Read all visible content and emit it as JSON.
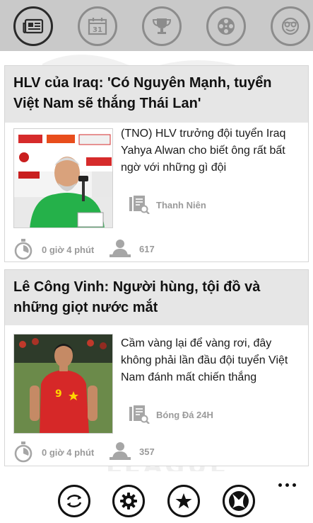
{
  "tabs": [
    {
      "icon": "news-icon",
      "active": true
    },
    {
      "icon": "calendar-icon",
      "day": "31",
      "active": false
    },
    {
      "icon": "trophy-icon",
      "active": false
    },
    {
      "icon": "film-reel-icon",
      "active": false
    },
    {
      "icon": "mask-icon",
      "active": false
    }
  ],
  "articles": [
    {
      "title": "HLV của Iraq: 'Có Nguyên Mạnh, tuyển Việt Nam sẽ thắng Thái Lan'",
      "summary": "(TNO) HLV trưởng đội tuyển Iraq Yahya Alwan cho biết ông rất bất ngờ với những gì đội",
      "source": "Thanh Niên",
      "time": "0 giờ 4 phút",
      "views": "617"
    },
    {
      "title": "Lê Công Vinh: Người hùng, tội đồ và những giọt nước mắt",
      "summary": "Cầm vàng lại để vàng rơi, đây không phải lần đầu đội tuyển Việt Nam đánh mất chiến thắng",
      "source": "Bóng Đá 24H",
      "time": "0 giờ 4 phút",
      "views": "357"
    }
  ],
  "appbar": {
    "buttons": [
      "refresh-icon",
      "settings-icon",
      "favorite-icon",
      "xbox-icon"
    ],
    "more_icon": "more-icon"
  },
  "colors": {
    "topbar_bg": "#c9c9c9",
    "card_head_bg": "#e6e6e6",
    "meta_gray": "#9a9a9a",
    "text_dark": "#111111"
  }
}
